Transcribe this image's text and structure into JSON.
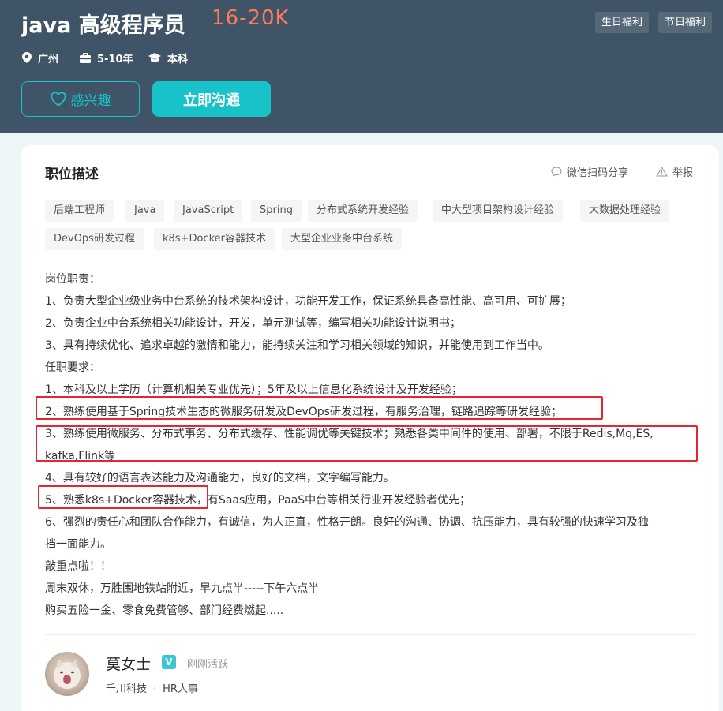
{
  "header": {
    "job_title": "java 高级程序员",
    "salary": "16-20K",
    "welfare_tags": [
      "生日福利",
      "节日福利"
    ],
    "location": "广州",
    "experience": "5-10年",
    "education": "本科",
    "interest_label": "感兴趣",
    "chat_label": "立即沟通"
  },
  "section": {
    "title": "职位描述",
    "share_label": "微信扫码分享",
    "report_label": "举报"
  },
  "tags": [
    "后端工程师",
    "Java",
    "JavaScript",
    "Spring",
    "分布式系统开发经验",
    "中大型项目架构设计经验",
    "大数据处理经验",
    "DevOps研发过程",
    "k8s+Docker容器技术",
    "大型企业业务中台系统"
  ],
  "description": [
    "岗位职责：",
    "1、负责大型企业级业务中台系统的技术架构设计，功能开发工作，保证系统具备高性能、高可用、可扩展；",
    "2、负责企业中台系统相关功能设计，开发，单元测试等，编写相关功能设计说明书；",
    "3、具有持续优化、追求卓越的激情和能力，能持续关注和学习相关领域的知识，并能使用到工作当中。",
    "任职要求：",
    "1、本科及以上学历（计算机相关专业优先）；5年及以上信息化系统设计及开发经验；",
    "2、熟练使用基于Spring技术生态的微服务研发及DevOps研发过程，有服务治理，链路追踪等研发经验；",
    "3、熟练使用微服务、分布式事务、分布式缓存、性能调优等关键技术；熟悉各类中间件的使用、部署，不限于Redis,Mq,ES,",
    "kafka,Flink等",
    "4、具有较好的语言表达能力及沟通能力，良好的文档，文字编写能力。",
    "5、熟悉k8s+Docker容器技术，有Saas应用，PaaS中台等相关行业开发经验者优先；",
    "6、强烈的责任心和团队合作能力，有诚信，为人正直，性格开朗。良好的沟通、协调、抗压能力，具有较强的快速学习及独",
    "挡一面能力。",
    "敲重点啦！！",
    "周末双休，万胜围地铁站附近，早九点半-----下午六点半",
    "购买五险一金、零食免费管够、部门经费燃起....."
  ],
  "recruiter": {
    "name": "莫女士",
    "verified_label": "V",
    "status": "刚刚活跃",
    "company": "千川科技",
    "separator": "·",
    "role": "HR人事"
  }
}
